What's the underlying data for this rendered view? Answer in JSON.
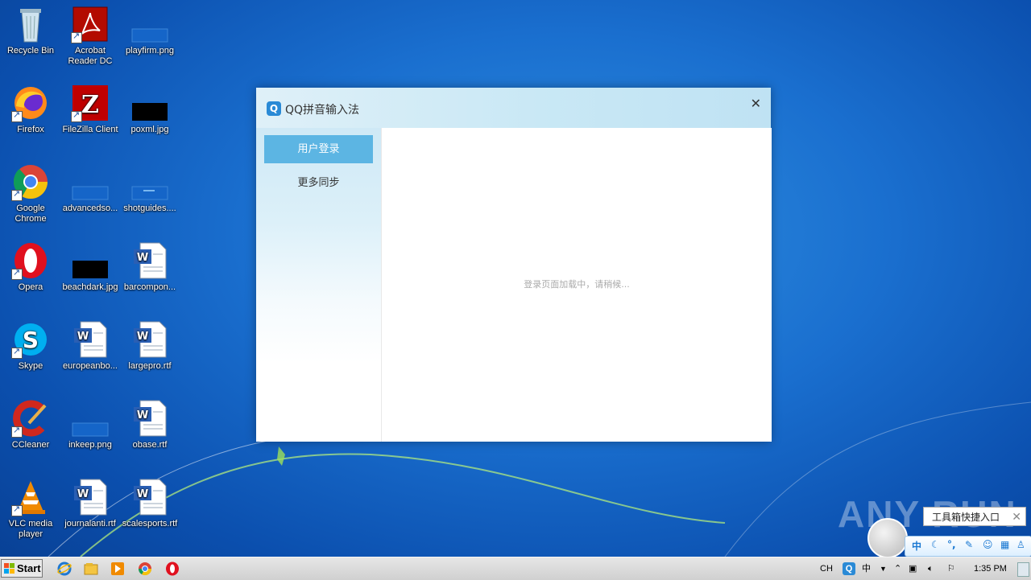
{
  "desktop": {
    "icons": [
      {
        "label": "Recycle Bin"
      },
      {
        "label": "Acrobat Reader DC"
      },
      {
        "label": "playfirm.png"
      },
      {
        "label": "Firefox"
      },
      {
        "label": "FileZilla Client"
      },
      {
        "label": "poxml.jpg"
      },
      {
        "label": "Google Chrome"
      },
      {
        "label": "advancedso..."
      },
      {
        "label": "shotguides...."
      },
      {
        "label": "Opera"
      },
      {
        "label": "beachdark.jpg"
      },
      {
        "label": "barcompon..."
      },
      {
        "label": "Skype"
      },
      {
        "label": "europeanbo..."
      },
      {
        "label": "largepro.rtf"
      },
      {
        "label": "CCleaner"
      },
      {
        "label": "inkeep.png"
      },
      {
        "label": "obase.rtf"
      },
      {
        "label": "VLC media player"
      },
      {
        "label": "journalanti.rtf"
      },
      {
        "label": "scalesports.rtf"
      }
    ]
  },
  "dialog": {
    "logo": "Q",
    "title": "QQ拼音输入法",
    "close": "✕",
    "sidebar": [
      "用户登录",
      "更多同步"
    ],
    "loading_text": "登录页面加载中，请稍候..."
  },
  "taskbar": {
    "start_label": "Start",
    "language": "CH",
    "time": "1:35 PM"
  },
  "ime": {
    "tip": "工具箱快捷入口",
    "tip_close": "✕",
    "mode": "中"
  },
  "watermark": "ANY RUN"
}
